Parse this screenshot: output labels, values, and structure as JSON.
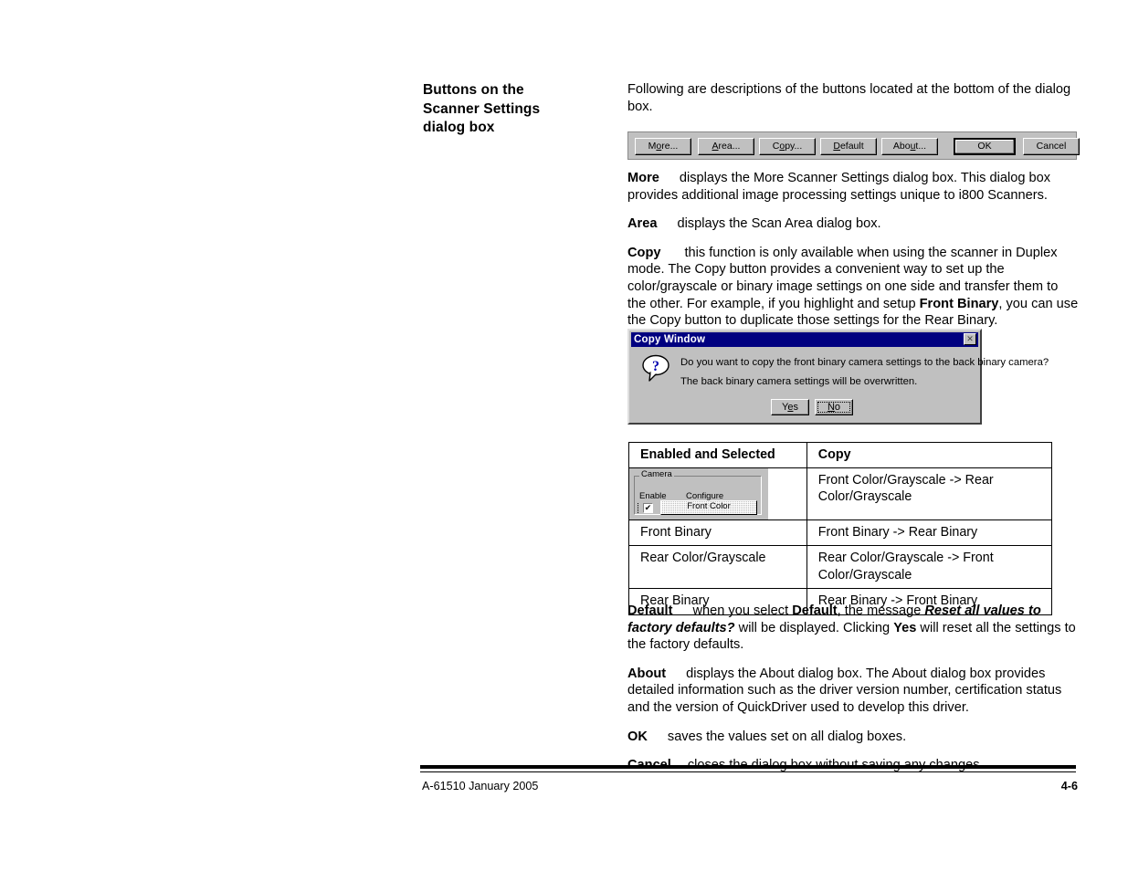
{
  "heading": {
    "line1": "Buttons on the",
    "line2": "Scanner Settings",
    "line3": "dialog box"
  },
  "intro": {
    "text": "Following are descriptions of the buttons located at the bottom of the dialog box."
  },
  "button_bar": {
    "buttons": [
      {
        "name": "more",
        "pre": "M",
        "accel": "o",
        "post": "re..."
      },
      {
        "name": "area",
        "pre": "",
        "accel": "A",
        "post": "rea..."
      },
      {
        "name": "copy",
        "pre": "C",
        "accel": "o",
        "post": "py..."
      },
      {
        "name": "default",
        "pre": "",
        "accel": "D",
        "post": "efault"
      },
      {
        "name": "about",
        "pre": "Abo",
        "accel": "u",
        "post": "t..."
      },
      {
        "name": "ok",
        "pre": "OK",
        "accel": "",
        "post": ""
      },
      {
        "name": "cancel",
        "pre": "Cancel",
        "accel": "",
        "post": ""
      }
    ]
  },
  "descriptions": {
    "more": {
      "term": "More",
      "text": "displays the More Scanner Settings dialog box. This dialog box provides additional image processing settings unique to i800 Scanners."
    },
    "area": {
      "term": "Area",
      "text": "displays the Scan Area dialog box."
    },
    "copy": {
      "term": "Copy",
      "part1": "this function is only available when using the scanner in Duplex mode. The Copy button provides a convenient way to set up the color/grayscale or binary image settings on one side and transfer them to the other. For example, if you highlight and setup ",
      "bold1": "Front Binary",
      "part2": ", you can use the Copy button to duplicate those settings for the Rear Binary."
    },
    "default": {
      "term": "Default",
      "part1": "when you select ",
      "bold1": "Default",
      "part2": ", the message ",
      "bolditalic1": "Reset all values to factory defaults?",
      "part3": " will be displayed. Clicking ",
      "bold2": "Yes",
      "part4": " will reset all the settings to the factory defaults."
    },
    "about": {
      "term": "About",
      "text": "displays the About dialog box. The About dialog box provides detailed information such as the driver version number, certification status and the version of QuickDriver used to develop this driver."
    },
    "ok": {
      "term": "OK",
      "text": "saves the values set on all dialog boxes."
    },
    "cancel": {
      "term": "Cancel",
      "text": "closes the dialog box without saving any changes."
    }
  },
  "copy_window": {
    "title": "Copy Window",
    "close_label": "✕",
    "icon": "question-bubble-icon",
    "message_line1": "Do you want to copy the front binary camera settings to the back binary camera?",
    "message_line2": "The back binary camera settings will be overwritten.",
    "yes_pre": "Y",
    "yes_accel": "e",
    "yes_post": "s",
    "no_pre": "",
    "no_accel": "N",
    "no_post": "o",
    "accent_titlebar": "#000080",
    "face_color": "#c0c0c0"
  },
  "copy_table": {
    "headers": [
      "Enabled and Selected",
      "Copy"
    ],
    "rows": [
      {
        "left_widget": true,
        "left": "",
        "right": "Front Color/Grayscale -> Rear Color/Grayscale"
      },
      {
        "left_widget": false,
        "left": "Front Binary",
        "right": "Front Binary -> Rear Binary"
      },
      {
        "left_widget": false,
        "left": "Rear Color/Grayscale",
        "right": "Rear Color/Grayscale -> Front Color/Grayscale"
      },
      {
        "left_widget": false,
        "left": "Rear Binary",
        "right": "Rear Binary -> Front Binary"
      }
    ],
    "camera_widget": {
      "legend": "Camera",
      "label_enable": "Enable",
      "label_configure": "Configure",
      "checkbox_checked": true,
      "check_glyph": "✔",
      "button_label": "Front Color"
    }
  },
  "footer": {
    "left": "A-61510 January 2005",
    "page": "4-6"
  }
}
